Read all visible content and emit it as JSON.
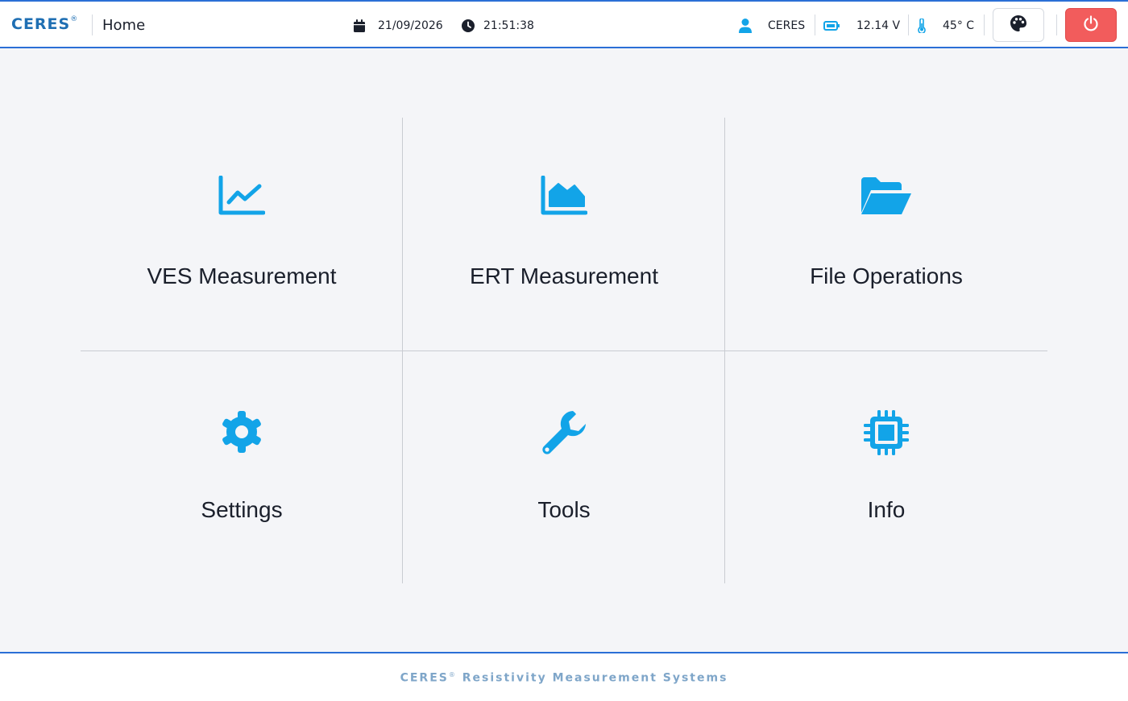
{
  "header": {
    "brand": "CERES",
    "brand_mark": "®",
    "page_title": "Home",
    "date": "21/09/2026",
    "time": "21:51:38",
    "user": "CERES",
    "battery": "12.14 V",
    "temperature": "45° C",
    "icons": {
      "date": "calendar-icon",
      "time": "clock-icon",
      "user": "user-icon",
      "battery": "battery-icon",
      "temperature": "thermometer-icon",
      "theme": "palette-icon",
      "power": "power-icon"
    }
  },
  "tiles": [
    {
      "label": "VES Measurement",
      "icon": "line-chart-icon"
    },
    {
      "label": "ERT Measurement",
      "icon": "area-chart-icon"
    },
    {
      "label": "File Operations",
      "icon": "folder-open-icon"
    },
    {
      "label": "Settings",
      "icon": "gear-icon"
    },
    {
      "label": "Tools",
      "icon": "wrench-icon"
    },
    {
      "label": "Info",
      "icon": "chip-icon"
    }
  ],
  "footer": {
    "brand": "CERES",
    "brand_mark": "®",
    "tagline": "Resistivity Measurement Systems"
  },
  "colors": {
    "accent": "#2b6fd6",
    "icon_blue": "#12a4e8",
    "power_red": "#f25c5c",
    "brand_blue": "#1f6fb3",
    "background": "#f4f5f8"
  }
}
